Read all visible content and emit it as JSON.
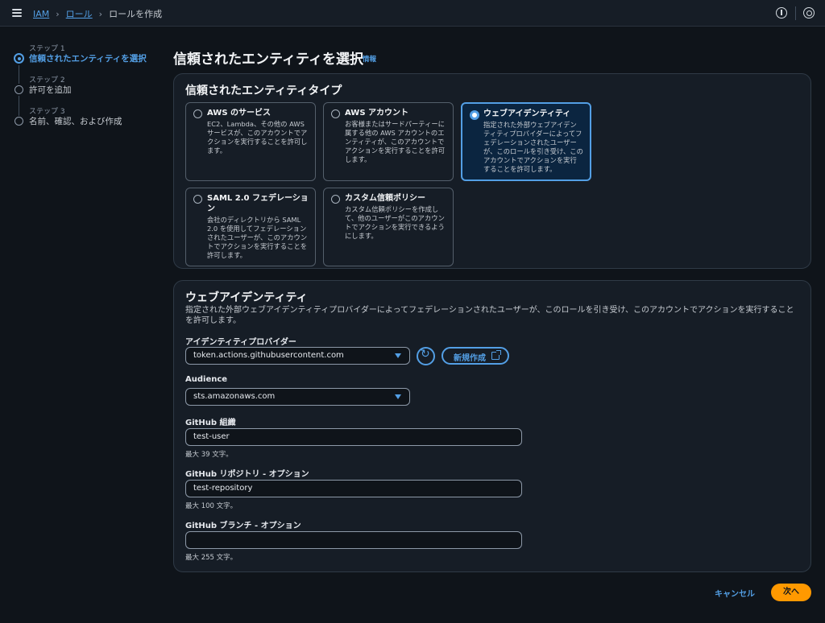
{
  "breadcrumb": {
    "items": [
      "IAM",
      "ロール"
    ],
    "current": "ロールを作成"
  },
  "steps": [
    {
      "sub": "ステップ 1",
      "label": "信頼されたエンティティを選択",
      "active": true
    },
    {
      "sub": "ステップ 2",
      "label": "許可を追加",
      "active": false
    },
    {
      "sub": "ステップ 3",
      "label": "名前、確認、および作成",
      "active": false
    }
  ],
  "page": {
    "title": "信頼されたエンティティを選択",
    "info": "情報"
  },
  "entity_type": {
    "title": "信頼されたエンティティタイプ",
    "options": [
      {
        "title": "AWS のサービス",
        "desc": "EC2、Lambda、その他の AWS サービスが、このアカウントでアクションを実行することを許可します。",
        "selected": false
      },
      {
        "title": "AWS アカウント",
        "desc": "お客様またはサードパーティーに属する他の AWS アカウントのエンティティが、このアカウントでアクションを実行することを許可します。",
        "selected": false
      },
      {
        "title": "ウェブアイデンティティ",
        "desc": "指定された外部ウェブアイデンティティプロバイダーによってフェデレーションされたユーザーが、このロールを引き受け、このアカウントでアクションを実行することを許可します。",
        "selected": true
      },
      {
        "title": "SAML 2.0 フェデレーション",
        "desc": "会社のディレクトリから SAML 2.0 を使用してフェデレーションされたユーザーが、このアカウントでアクションを実行することを許可します。",
        "selected": false
      },
      {
        "title": "カスタム信頼ポリシー",
        "desc": "カスタム信頼ポリシーを作成して、他のユーザーがこのアカウントでアクションを実行できるようにします。",
        "selected": false
      }
    ]
  },
  "web_identity": {
    "title": "ウェブアイデンティティ",
    "desc": "指定された外部ウェブアイデンティティプロバイダーによってフェデレーションされたユーザーが、このロールを引き受け、このアカウントでアクションを実行することを許可します。",
    "provider_label": "アイデンティティプロバイダー",
    "provider_value": "token.actions.githubusercontent.com",
    "create_new": "新規作成",
    "audience_label": "Audience",
    "audience_value": "sts.amazonaws.com",
    "org_label": "GitHub 組織",
    "org_value": "test-user",
    "org_hint": "最大 39 文字。",
    "repo_label": "GitHub リポジトリ - オプション",
    "repo_value": "test-repository",
    "repo_hint": "最大 100 文字。",
    "branch_label": "GitHub ブランチ - オプション",
    "branch_value": "",
    "branch_hint": "最大 255 文字。"
  },
  "footer": {
    "cancel": "キャンセル",
    "next": "次へ"
  },
  "colors": {
    "accent": "#539fe5",
    "primary_button": "#ff9900",
    "background": "#0f141a",
    "panel": "#161d26"
  }
}
